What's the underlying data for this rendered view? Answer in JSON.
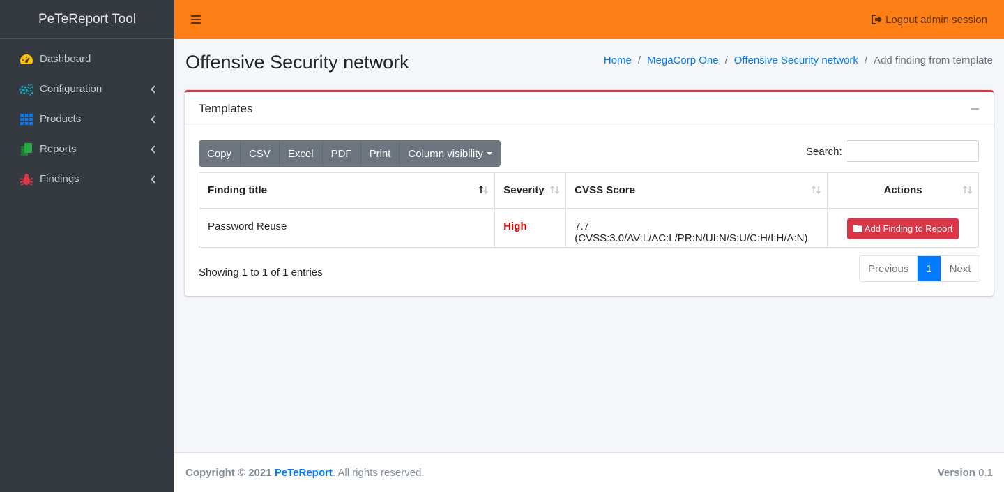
{
  "brand": "PeTeReport Tool",
  "sidebar": {
    "items": [
      {
        "label": "Dashboard",
        "icon": "tachometer-icon",
        "color": "#ffc107"
      },
      {
        "label": "Configuration",
        "icon": "cogs-icon",
        "color": "#17a2b8"
      },
      {
        "label": "Products",
        "icon": "grid-icon",
        "color": "#007bff"
      },
      {
        "label": "Reports",
        "icon": "copy-icon",
        "color": "#28a745"
      },
      {
        "label": "Findings",
        "icon": "bug-icon",
        "color": "#dc3545"
      }
    ]
  },
  "header": {
    "logout": "Logout admin session",
    "bg_color": "#fd7e14"
  },
  "page": {
    "title": "Offensive Security network"
  },
  "breadcrumb": {
    "items": [
      "Home",
      "MegaCorp One",
      "Offensive Security network"
    ],
    "active": "Add finding from template"
  },
  "card": {
    "title": "Templates",
    "buttons": [
      "Copy",
      "CSV",
      "Excel",
      "PDF",
      "Print",
      "Column visibility"
    ],
    "search_label": "Search:",
    "search_value": ""
  },
  "table": {
    "columns": [
      "Finding title",
      "Severity",
      "CVSS Score",
      "Actions"
    ],
    "rows": [
      {
        "title": "Password Reuse",
        "severity": "High",
        "cvss": "7.7 (CVSS:3.0/AV:L/AC:L/PR:N/UI:N/S:U/C:H/I:H/A:N)",
        "action": "Add Finding to Report"
      }
    ],
    "info": "Showing 1 to 1 of 1 entries"
  },
  "pagination": {
    "previous": "Previous",
    "current": "1",
    "next": "Next"
  },
  "footer": {
    "copyright": "Copyright © 2021",
    "link": "PeTeReport",
    "rest": ". All rights reserved.",
    "version_label": "Version",
    "version": "0.1"
  }
}
